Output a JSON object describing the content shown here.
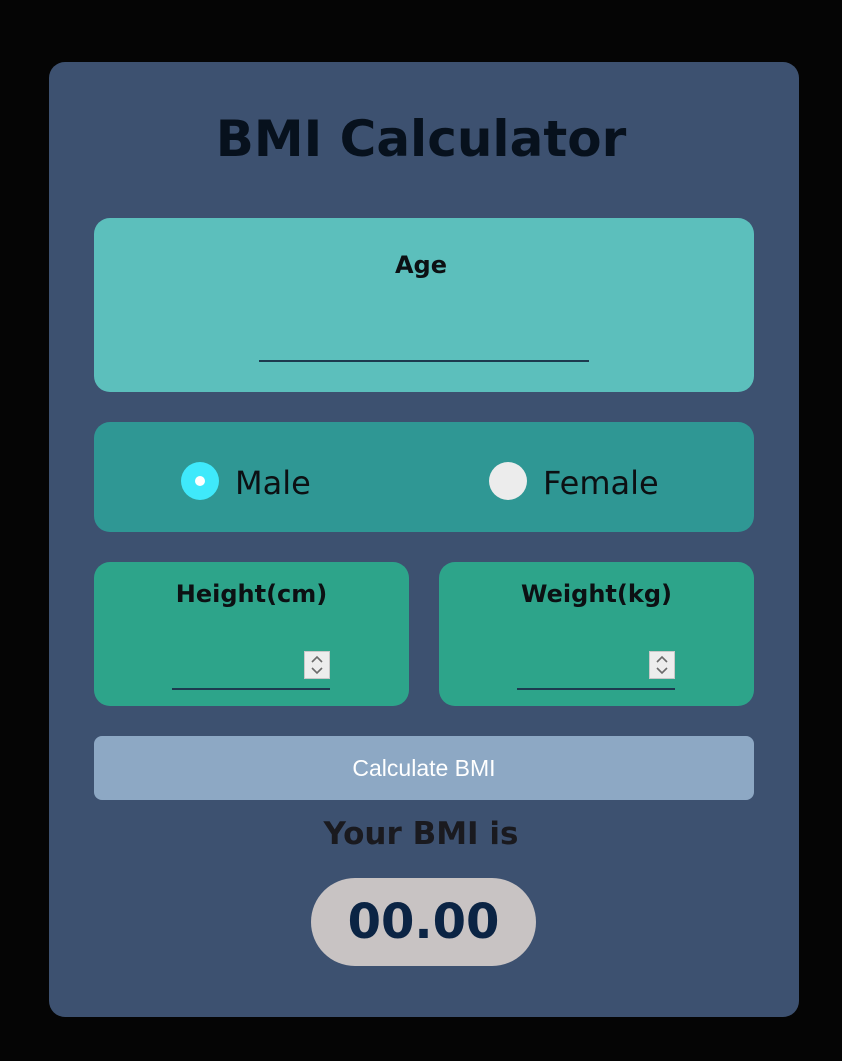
{
  "title": "BMI Calculator",
  "age": {
    "label": "Age",
    "value": ""
  },
  "gender": {
    "selected": "Male",
    "options": [
      {
        "label": "Male",
        "checked": true
      },
      {
        "label": "Female",
        "checked": false
      }
    ]
  },
  "height": {
    "label": "Height(cm)",
    "value": ""
  },
  "weight": {
    "label": "Weight(kg)",
    "value": ""
  },
  "calculate_button": {
    "label": "Calculate BMI"
  },
  "result": {
    "label": "Your BMI is",
    "value": "00.00"
  },
  "colors": {
    "page_background": "#050505",
    "card_background": "#3d5170",
    "age_box": "#5cbfbc",
    "gender_box": "#2f9794",
    "metric_box": "#2da48a",
    "radio_selected": "#3fe9fb",
    "button": "#8da8c4",
    "result_pill": "#c8c3c3",
    "result_text": "#0b2444"
  },
  "icons": {
    "stepper": "up-down-chevron-icon"
  }
}
